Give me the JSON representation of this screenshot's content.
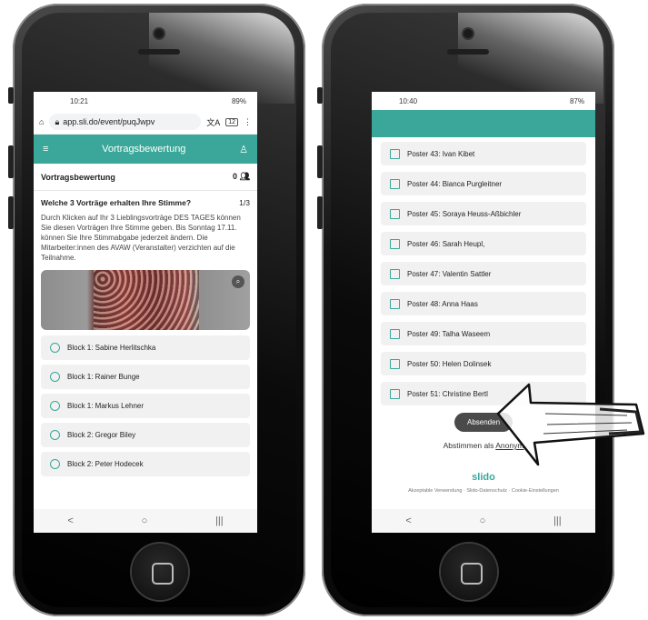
{
  "left": {
    "status": {
      "time": "10:21",
      "right": "89%"
    },
    "url": {
      "text": "app.sli.do/event/puqJwpv",
      "tabs": "12"
    },
    "appbar": {
      "title": "Vortragsbewertung"
    },
    "section": {
      "title": "Vortragsbewertung",
      "count": "0"
    },
    "question": {
      "title": "Welche 3 Vorträge erhalten Ihre Stimme?",
      "progress": "1/3",
      "description": "Durch Klicken auf Ihr 3 Lieblingsvorträge DES TAGES können Sie diesen Vorträgen Ihre Stimme geben. Bis Sonntag 17.11. können Sie Ihre Stimmabgabe jederzeit ändern. Die Mitarbeiter:innen des AVAW (Veranstalter) verzichten auf die Teilnahme."
    },
    "options": [
      "Block 1: Sabine Herlitschka",
      "Block 1: Rainer Bunge",
      "Block 1: Markus Lehner",
      "Block 2: Gregor Biley",
      "Block 2: Peter Hodecek"
    ]
  },
  "right": {
    "status": {
      "time": "10:40",
      "right": "87%"
    },
    "options": [
      "Poster 43: Ivan Kibet",
      "Poster 44: Bianca Purgleitner",
      "Poster 45: Soraya Heuss-Aßbichler",
      "Poster 46: Sarah Heupl,",
      "Poster 47: Valentin Sattler",
      "Poster 48: Anna Haas",
      "Poster 49: Talha Waseem",
      "Poster 50: Helen Dolinsek",
      "Poster 51: Christine Bertl"
    ],
    "submit_label": "Absenden",
    "anon_prefix": "Abstimmen als",
    "anon_link": "Anonym",
    "brand": "slido",
    "footer": "Akzeptable Verwendung · Slido-Datenschutz · Cookie-Einstellungen"
  },
  "nav": {
    "back": "<",
    "home": "○",
    "recent": "|||"
  },
  "colors": {
    "accent": "#3aa79a",
    "button": "#4a4a4a"
  }
}
